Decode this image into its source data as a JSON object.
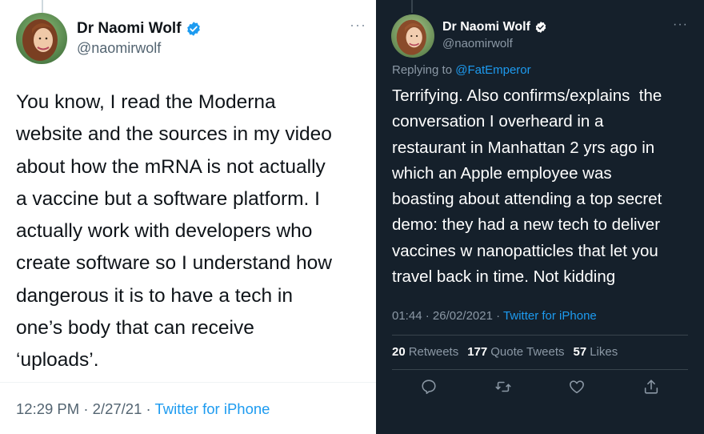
{
  "left_tweet": {
    "author": {
      "name": "Dr Naomi Wolf",
      "handle": "@naomirwolf",
      "verified_icon": "verified-badge-icon"
    },
    "lines": [
      "You know, I read the Moderna",
      "website and the sources in my video",
      "about how the mRNA is not actually",
      "a vaccine but a software platform. I",
      "actually work with developers who",
      "create software so I understand how",
      "dangerous it is to have a tech in",
      "one’s body that can receive",
      "‘uploads’."
    ],
    "time": "12:29 PM",
    "date": "2/27/21",
    "source": "Twitter for iPhone",
    "more_icon": "···"
  },
  "right_tweet": {
    "author": {
      "name": "Dr Naomi Wolf",
      "handle": "@naomirwolf",
      "verified_icon": "verified-badge-icon"
    },
    "replying_prefix": "Replying to",
    "replying_to": "@FatEmperor",
    "lines": [
      "Terrifying. Also confirms/explains  the",
      "conversation I overheard in a",
      "restaurant in Manhattan 2 yrs ago in",
      "which an Apple employee was",
      "boasting about attending a top secret",
      "demo: they had a new tech to deliver",
      "vaccines w nanopatticles that let you",
      "travel back in time. Not kidding"
    ],
    "time": "01:44",
    "date": "26/02/2021",
    "source": "Twitter for iPhone",
    "stats": {
      "retweets_count": "20",
      "retweets_label": "Retweets",
      "quotes_count": "177",
      "quotes_label": "Quote Tweets",
      "likes_count": "57",
      "likes_label": "Likes"
    },
    "more_icon": "···",
    "actions": [
      "reply-icon",
      "retweet-icon",
      "like-icon",
      "share-icon"
    ]
  },
  "colors": {
    "link_blue": "#1d9bf0",
    "dark_bg": "#15202b",
    "muted_gray": "#8b98a5"
  }
}
